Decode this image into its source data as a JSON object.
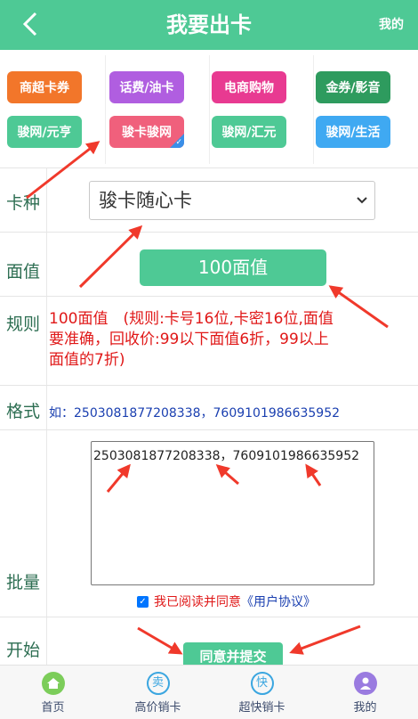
{
  "header": {
    "back_label": "‹",
    "title": "我要出卡",
    "right_link": "我的"
  },
  "categories": [
    {
      "label": "商超卡券",
      "color": "#f2762a"
    },
    {
      "label": "话费/油卡",
      "color": "#b05ee0"
    },
    {
      "label": "电商购物",
      "color": "#e83a91"
    },
    {
      "label": "金券/影音",
      "color": "#2e9b5e"
    },
    {
      "label": "骏网/元亨",
      "color": "#4ec995"
    },
    {
      "label": "骏卡骏网",
      "color": "#f0607c",
      "selected": true
    },
    {
      "label": "骏网/汇元",
      "color": "#4ec995"
    },
    {
      "label": "骏网/生活",
      "color": "#3fa9f2"
    }
  ],
  "form": {
    "card_type": {
      "label": "卡种",
      "value": "骏卡随心卡"
    },
    "face_value": {
      "label": "面值",
      "value": "100面值"
    },
    "rule": {
      "label": "规则",
      "text": "100面值　(规则:卡号16位,卡密16位,面值要准确，回收价:99以下面值6折，99以上面值的7折)"
    },
    "format": {
      "label": "格式",
      "text": "如：2503081877208338，7609101986635952"
    },
    "batch": {
      "label": "批量",
      "value": "2503081877208338，7609101986635952"
    },
    "agreement": {
      "checked": true,
      "text": "我已阅读并同意",
      "link": "《用户协议》"
    },
    "start": {
      "label": "开始",
      "button": "同意并提交"
    }
  },
  "tabbar": [
    {
      "label": "首页",
      "icon": "home-icon",
      "color": "#7ccd5a"
    },
    {
      "label": "高价销卡",
      "icon": "mai-icon",
      "color": "#3ba6e0"
    },
    {
      "label": "超快销卡",
      "icon": "kuai-icon",
      "color": "#3ba6e0"
    },
    {
      "label": "我的",
      "icon": "user-icon",
      "color": "#9a7be0"
    }
  ]
}
